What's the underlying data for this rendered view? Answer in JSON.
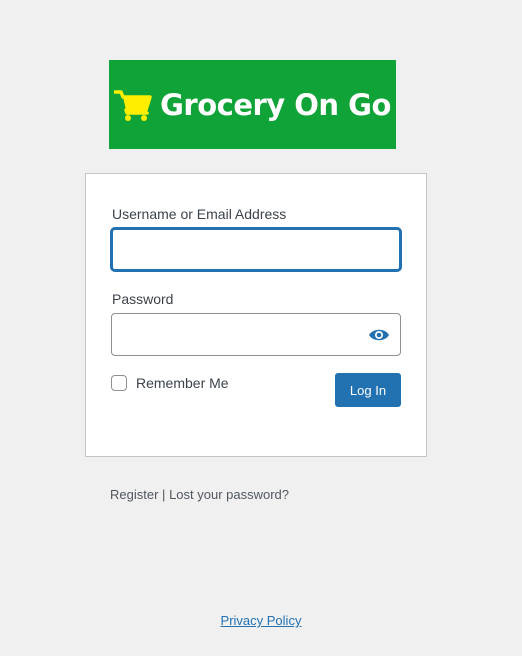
{
  "logo": {
    "brand_text": "Grocery On Go",
    "background_color": "#10a338",
    "icon": "shopping-cart-icon",
    "icon_color": "#ffee00"
  },
  "form": {
    "username_label": "Username or Email Address",
    "username_value": "",
    "password_label": "Password",
    "password_value": "",
    "show_password_icon": "eye-icon",
    "remember_label": "Remember Me",
    "remember_checked": false,
    "login_label": "Log In"
  },
  "nav": {
    "register_label": "Register",
    "separator": "|",
    "lost_password_label": "Lost your password?"
  },
  "footer": {
    "privacy_label": "Privacy Policy"
  },
  "colors": {
    "accent": "#2271b1",
    "background": "#f0f0f1"
  }
}
